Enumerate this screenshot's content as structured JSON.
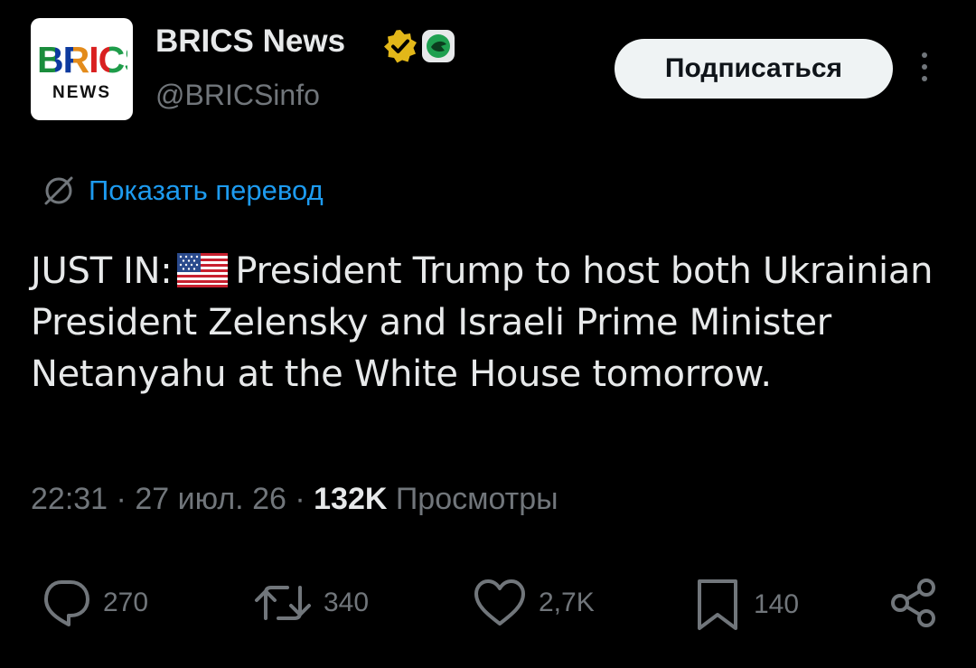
{
  "profile": {
    "logo_top": "BRICS",
    "logo_bottom": "NEWS",
    "name": "BRICS News",
    "handle": "@BRICSinfo",
    "verified_icon": "gold-check-badge",
    "affiliate_icon": "green-affiliate-badge"
  },
  "subscribe_label": "Подписаться",
  "translate_label": "Показать перевод",
  "tweet": {
    "prefix": "JUST IN:",
    "flag": "us-flag",
    "body": "President Trump to host both Ukrainian President Zelensky and Israeli Prime Minister Netanyahu at the White House tomorrow."
  },
  "meta": {
    "time": "22:31",
    "date": "27 июл. 26",
    "views": "132K",
    "views_label": "Просмотры"
  },
  "actions": {
    "replies": "270",
    "reposts": "340",
    "likes": "2,7K",
    "bookmarks": "140"
  },
  "colors": {
    "background": "#000000",
    "text": "#e7e9ea",
    "secondary": "#71767b",
    "link": "#1d9bf0",
    "badge_gold": "#e2b719"
  }
}
